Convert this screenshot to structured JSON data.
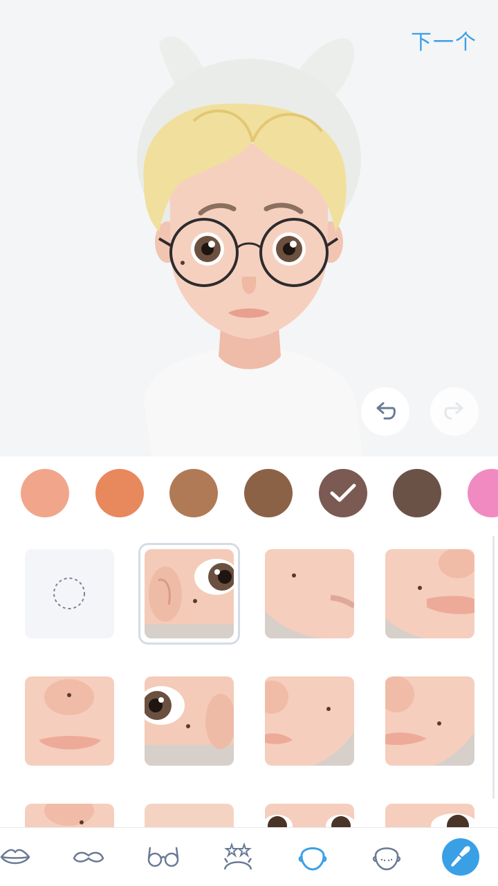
{
  "header": {
    "next_label": "下一个"
  },
  "controls": {
    "undo_icon": "undo-icon",
    "redo_icon": "redo-icon"
  },
  "palette": {
    "selected_index": 4,
    "colors": [
      "#f1a68c",
      "#e8885d",
      "#b07a56",
      "#8c6246",
      "#7a5a52",
      "#6b5247",
      "#f08ac0"
    ]
  },
  "mole_options": [
    {
      "name": "none",
      "icon": "none-dashed-circle-icon"
    },
    {
      "name": "mole-cheek-under-eye",
      "selected": true
    },
    {
      "name": "mole-cheek-side"
    },
    {
      "name": "mole-lip-corner"
    },
    {
      "name": "mole-nose-tip"
    },
    {
      "name": "mole-under-eye-ear"
    },
    {
      "name": "mole-cheek-center"
    },
    {
      "name": "mole-cheek-lower"
    },
    {
      "name": "mole-nose-lower"
    },
    {
      "name": "mole-forehead"
    },
    {
      "name": "mole-eyes"
    },
    {
      "name": "mole-eye-corner"
    }
  ],
  "toolbar": {
    "selected_index": 4,
    "items": [
      "lips-icon",
      "mustache-icon",
      "glasses-icon",
      "headpiece-icon",
      "face-shape-icon",
      "face-freckles-icon",
      "makeup-brush-icon"
    ],
    "accent": "#3aa0e6"
  }
}
